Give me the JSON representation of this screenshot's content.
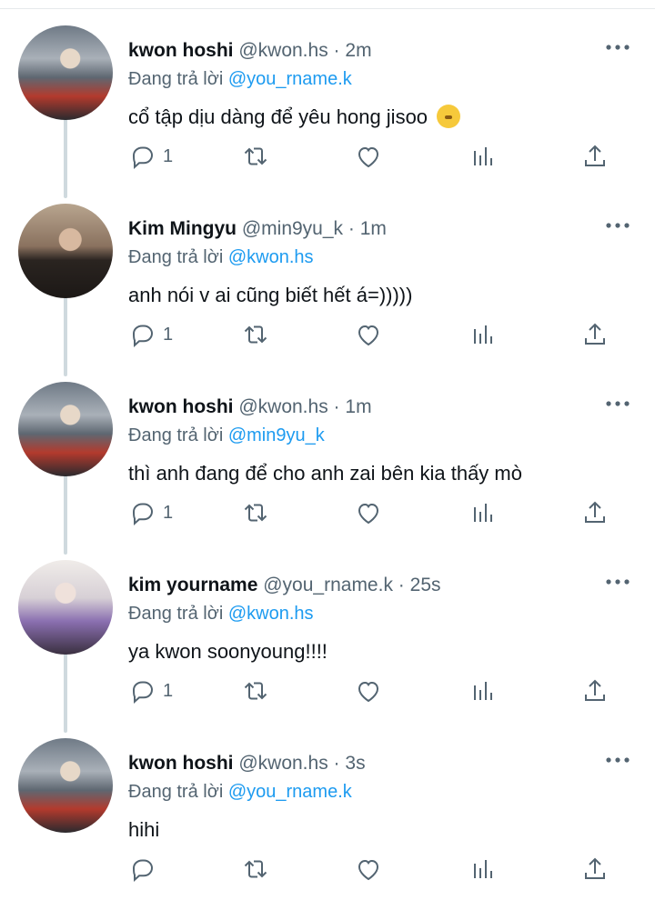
{
  "tweets": [
    {
      "name": "kwon hoshi",
      "handle": "@kwon.hs",
      "separator": "·",
      "time": "2m",
      "reply_prefix": "Đang trả lời",
      "reply_to": "@you_rname.k",
      "text": "cổ tập dịu dàng để yêu hong jisoo",
      "reply_count": "1",
      "avatar_icon": "avatar-hoshi"
    },
    {
      "name": "Kim Mingyu",
      "handle": "@min9yu_k",
      "separator": "·",
      "time": "1m",
      "reply_prefix": "Đang trả lời",
      "reply_to": "@kwon.hs",
      "text": "anh nói v ai cũng biết hết á=)))))",
      "reply_count": "1",
      "avatar_icon": "avatar-mingyu"
    },
    {
      "name": "kwon hoshi",
      "handle": "@kwon.hs",
      "separator": "·",
      "time": "1m",
      "reply_prefix": "Đang trả lời",
      "reply_to": "@min9yu_k",
      "text": "thì anh đang để cho anh zai bên kia thấy mò",
      "reply_count": "1",
      "avatar_icon": "avatar-hoshi"
    },
    {
      "name": "kim yourname",
      "handle": "@you_rname.k",
      "separator": "·",
      "time": "25s",
      "reply_prefix": "Đang trả lời",
      "reply_to": "@kwon.hs",
      "text": "ya kwon soonyoung!!!!",
      "reply_count": "1",
      "avatar_icon": "avatar-kim"
    },
    {
      "name": "kwon hoshi",
      "handle": "@kwon.hs",
      "separator": "·",
      "time": "3s",
      "reply_prefix": "Đang trả lời",
      "reply_to": "@you_rname.k",
      "text": "hihi",
      "reply_count": "",
      "avatar_icon": "avatar-hoshi"
    }
  ],
  "icons": {
    "reply": "reply-icon",
    "retweet": "retweet-icon",
    "like": "heart-icon",
    "views": "bar-chart-icon",
    "share": "share-icon",
    "more": "more-icon",
    "emoji": "shushing-face-emoji"
  },
  "colors": {
    "mention": "#1d9bf0",
    "secondary_text": "#536471",
    "primary_text": "#0f1419",
    "thread_line": "#cfd9de"
  }
}
